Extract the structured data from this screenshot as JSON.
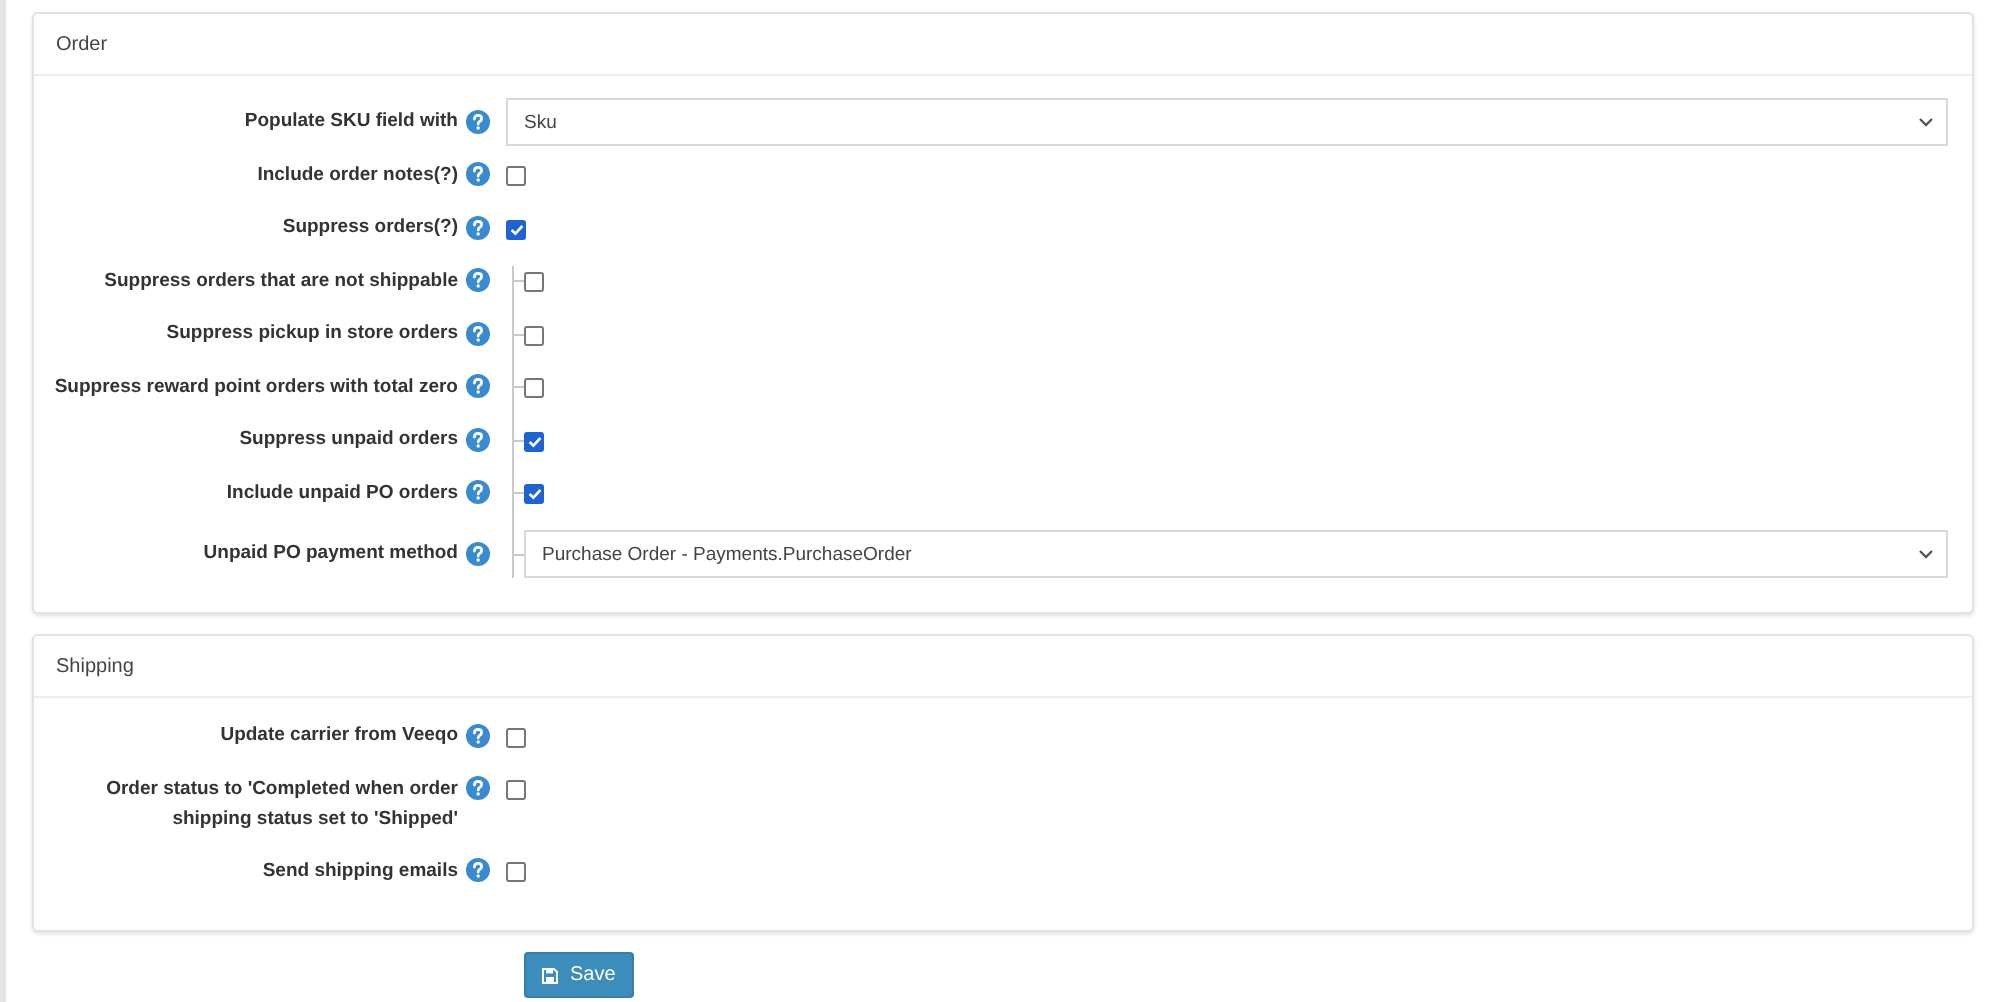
{
  "sections": [
    {
      "title": "Order",
      "rows": [
        {
          "kind": "select",
          "label": "Populate SKU field with",
          "value": "Sku"
        },
        {
          "kind": "checkbox",
          "label": "Include order notes(?)",
          "checked": false
        },
        {
          "kind": "checkbox",
          "label": "Suppress orders(?)",
          "checked": true,
          "children": [
            {
              "kind": "checkbox",
              "label": "Suppress orders that are not shippable",
              "checked": false
            },
            {
              "kind": "checkbox",
              "label": "Suppress pickup in store orders",
              "checked": false
            },
            {
              "kind": "checkbox",
              "label": "Suppress reward point orders with total zero",
              "checked": false
            },
            {
              "kind": "checkbox",
              "label": "Suppress unpaid orders",
              "checked": true
            },
            {
              "kind": "checkbox",
              "label": "Include unpaid PO orders",
              "checked": true
            },
            {
              "kind": "select",
              "label": "Unpaid PO payment method",
              "value": "Purchase Order - Payments.PurchaseOrder"
            }
          ]
        }
      ]
    },
    {
      "title": "Shipping",
      "rows": [
        {
          "kind": "checkbox",
          "label": "Update carrier from Veeqo",
          "checked": false
        },
        {
          "kind": "checkbox",
          "label": "Order status to 'Completed when order shipping status set to 'Shipped'",
          "checked": false
        },
        {
          "kind": "checkbox",
          "label": "Send shipping emails",
          "checked": false
        }
      ]
    }
  ],
  "save_button": "Save"
}
